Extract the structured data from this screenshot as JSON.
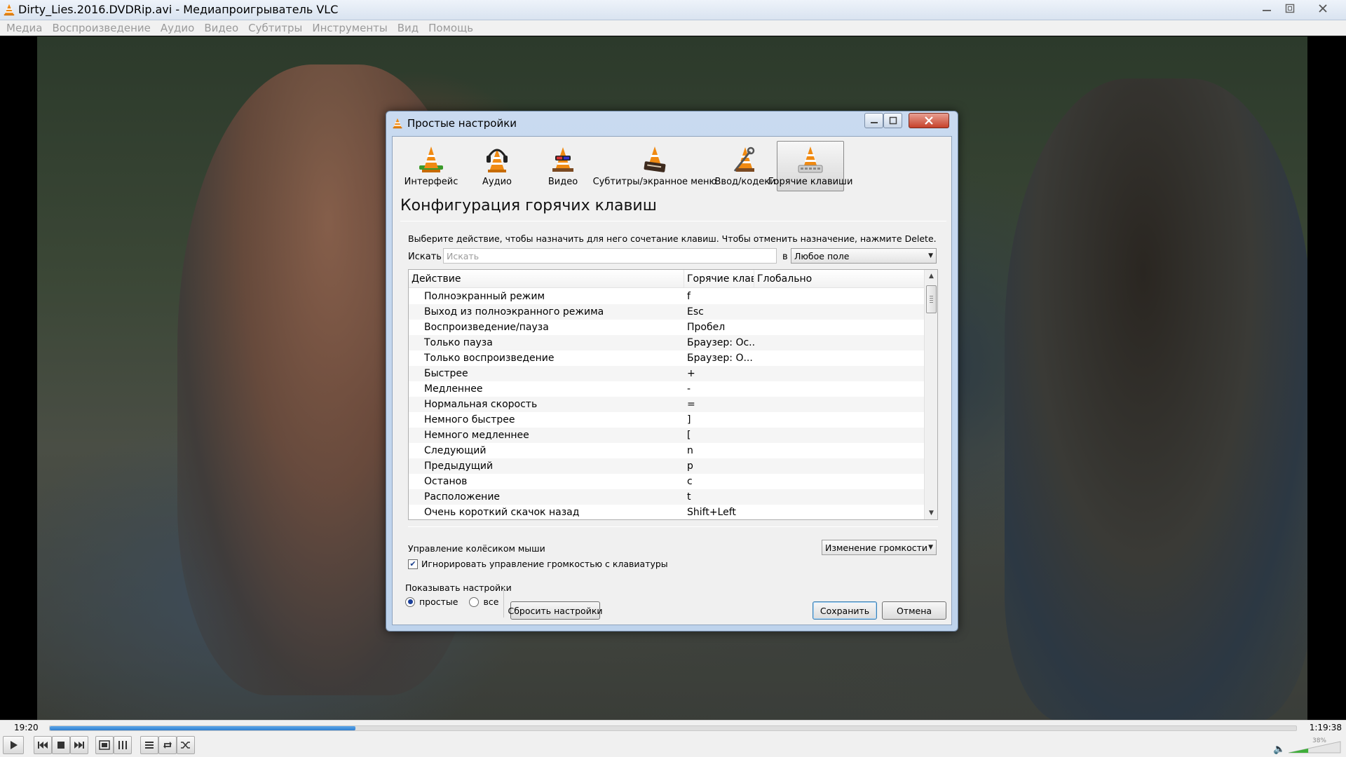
{
  "window": {
    "title": "Dirty_Lies.2016.DVDRip.avi - Медиапроигрыватель VLC"
  },
  "menu": [
    "Медиа",
    "Воспроизведение",
    "Аудио",
    "Видео",
    "Субтитры",
    "Инструменты",
    "Вид",
    "Помощь"
  ],
  "playback": {
    "current_time": "19:20",
    "total_time": "1:19:38",
    "progress_fraction": 0.245,
    "volume_label": "38%",
    "volume_fraction": 0.38
  },
  "dialog": {
    "title": "Простые настройки",
    "categories": [
      {
        "label": "Интерфейс",
        "icon": "interface-cone-icon",
        "active": false
      },
      {
        "label": "Аудио",
        "icon": "audio-headphones-cone-icon",
        "active": false
      },
      {
        "label": "Видео",
        "icon": "video-glasses-cone-icon",
        "active": false
      },
      {
        "label": "Субтитры/экранное меню",
        "icon": "subtitles-cone-icon",
        "active": false
      },
      {
        "label": "Ввод/кодеки",
        "icon": "input-codecs-cone-icon",
        "active": false
      },
      {
        "label": "Горячие клавиши",
        "icon": "hotkeys-cone-icon",
        "active": true
      }
    ],
    "section_title": "Конфигурация горячих клавиш",
    "hint": "Выберите действие, чтобы назначить для него сочетание клавиш. Чтобы отменить назначение, нажмите Delete.",
    "search": {
      "label": "Искать",
      "placeholder": "Искать",
      "value": "",
      "in_label": "в",
      "field_selected": "Любое поле"
    },
    "table": {
      "columns": [
        "Действие",
        "Горячие клав",
        "Глобально"
      ],
      "rows": [
        {
          "action": "Полноэкранный режим",
          "hotkey": "f",
          "global": ""
        },
        {
          "action": "Выход из полноэкранного режима",
          "hotkey": "Esc",
          "global": ""
        },
        {
          "action": "Воспроизведение/пауза",
          "hotkey": "Пробел",
          "global": ""
        },
        {
          "action": "Только пауза",
          "hotkey": "Браузер: Ос...",
          "global": ""
        },
        {
          "action": "Только воспроизведение",
          "hotkey": "Браузер: О...",
          "global": ""
        },
        {
          "action": "Быстрее",
          "hotkey": "+",
          "global": ""
        },
        {
          "action": "Медленнее",
          "hotkey": "-",
          "global": ""
        },
        {
          "action": "Нормальная скорость",
          "hotkey": "=",
          "global": ""
        },
        {
          "action": "Немного быстрее",
          "hotkey": "]",
          "global": ""
        },
        {
          "action": "Немного медленнее",
          "hotkey": "[",
          "global": ""
        },
        {
          "action": "Следующий",
          "hotkey": "n",
          "global": ""
        },
        {
          "action": "Предыдущий",
          "hotkey": "p",
          "global": ""
        },
        {
          "action": "Останов",
          "hotkey": "c",
          "global": ""
        },
        {
          "action": "Расположение",
          "hotkey": "t",
          "global": ""
        },
        {
          "action": "Очень короткий скачок назад",
          "hotkey": "Shift+Left",
          "global": ""
        }
      ]
    },
    "mouse_wheel": {
      "label": "Управление колёсиком мыши",
      "selected": "Изменение громкости"
    },
    "ignore_volume_checkbox": {
      "label": "Игнорировать управление громкостью с клавиатуры",
      "checked": true
    },
    "show_settings": {
      "label": "Показывать настройки",
      "simple_label": "простые",
      "all_label": "все",
      "selected": "простые"
    },
    "buttons": {
      "reset": "Сбросить настройки",
      "save": "Сохранить",
      "cancel": "Отмена"
    }
  },
  "colors": {
    "seek_fill": "#2f7fd0",
    "dialog_frame": "#c9daf0",
    "vlc_orange": "#f08a12"
  }
}
